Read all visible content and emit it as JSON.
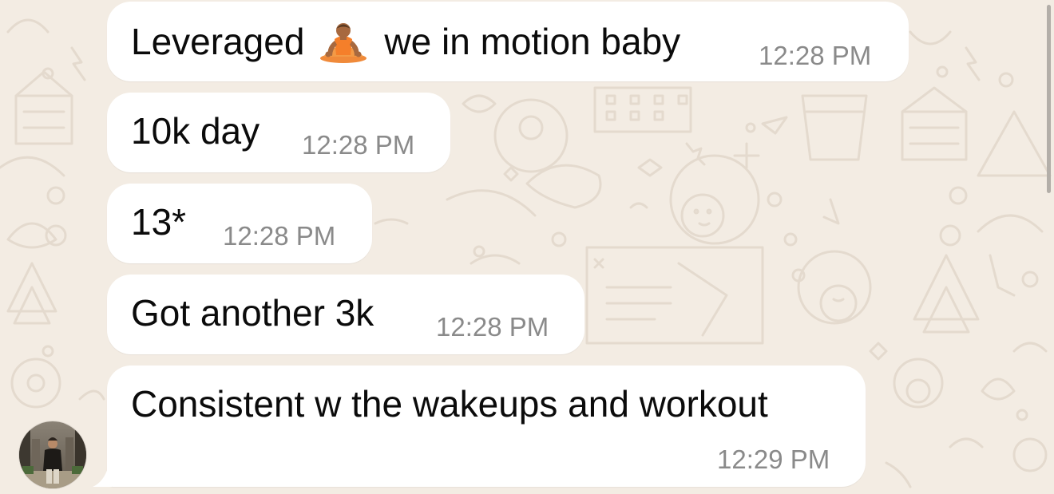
{
  "messages": [
    {
      "text_before": "Leveraged",
      "emoji": "person-lotus-position-emoji",
      "text_after": "we in motion baby",
      "time": "12:28 PM"
    },
    {
      "text": "10k day",
      "time": "12:28 PM"
    },
    {
      "text": "13*",
      "time": "12:28 PM"
    },
    {
      "text": "Got another 3k",
      "time": "12:28 PM"
    },
    {
      "text": "Consistent w the wakeups and workout",
      "time": "12:29 PM"
    }
  ],
  "colors": {
    "wallpaper": "#f3ece3",
    "doodle": "#e4dace",
    "bubble": "#ffffff",
    "text": "#0b0b0b",
    "timestamp": "#8a8a8a"
  }
}
